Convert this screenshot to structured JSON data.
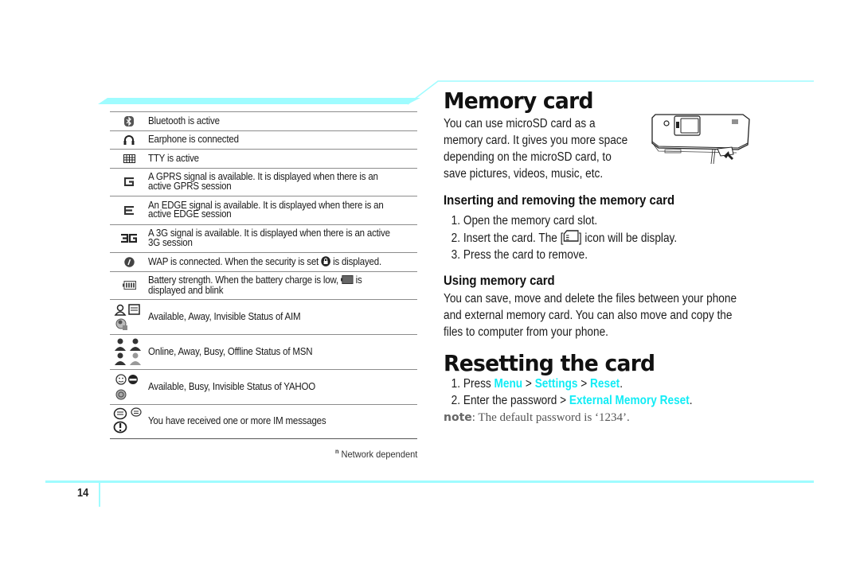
{
  "colors": {
    "accent_cyan": "#12ecf5",
    "band_cyan": "#9ffcff",
    "rule_gray": "#8c8c8c"
  },
  "status_icons": {
    "rows": [
      {
        "icon": "bluetooth-icon",
        "text": "Bluetooth is active"
      },
      {
        "icon": "headphones-icon",
        "text": "Earphone is connected"
      },
      {
        "icon": "tty-icon",
        "text": "TTY is active"
      },
      {
        "icon": "gprs-icon",
        "text": "A GPRS signal is available. It is displayed when there is an active GPRS session"
      },
      {
        "icon": "edge-icon",
        "text": "An EDGE signal is available. It is displayed when there is an active EDGE session"
      },
      {
        "icon": "3g-icon",
        "text": "A 3G signal is available. It is displayed when there is an active 3G session"
      },
      {
        "icon": "wap-icon",
        "text_before": "WAP is connected. When the security is set",
        "inline_icon": "lock-icon",
        "text_after": "is displayed."
      },
      {
        "icon": "battery-icon",
        "text_before": "Battery strength. When the battery charge is low,",
        "inline_icon": "battery-low-icon",
        "text_after": "is displayed and blink"
      },
      {
        "icon": "aim-status-icons",
        "text": "Available, Away, Invisible Status of AIM"
      },
      {
        "icon": "msn-status-icons",
        "text": "Online, Away, Busy, Offline Status of MSN"
      },
      {
        "icon": "yahoo-status-icons",
        "text": "Available, Busy, Invisible Status of YAHOO"
      },
      {
        "icon": "im-message-icons",
        "text": "You have received one or more IM messages"
      }
    ],
    "footnote_mark": "n",
    "footnote": "Network dependent"
  },
  "memory_card": {
    "title": "Memory card",
    "intro": "You can use microSD card as a memory card. It gives you more space depending on the microSD card, to save pictures, videos, music, etc.",
    "inserting": {
      "heading": "Inserting and removing the memory card",
      "steps": [
        {
          "num": "1.",
          "text": "Open the memory card slot."
        },
        {
          "num": "2.",
          "text_before": "Insert the card. The [",
          "text_after": "] icon will be display."
        },
        {
          "num": "3.",
          "text": "Press the card to remove."
        }
      ]
    },
    "using": {
      "heading": "Using memory card",
      "body": "You can save, move and delete the files between your phone and external memory card. You can also move and copy the files to computer from your phone."
    }
  },
  "resetting": {
    "title": "Resetting the card",
    "step1": {
      "num": "1.",
      "prefix": "Press ",
      "menu": "Menu",
      "sep1": " > ",
      "settings": "Settings",
      "sep2": " > ",
      "reset": "Reset",
      "end": "."
    },
    "step2": {
      "num": "2.",
      "prefix": "Enter the password > ",
      "target": "External Memory Reset",
      "end": "."
    },
    "note_label": "note",
    "note_text": ": The default password is ‘1234’."
  },
  "page_number": "14"
}
